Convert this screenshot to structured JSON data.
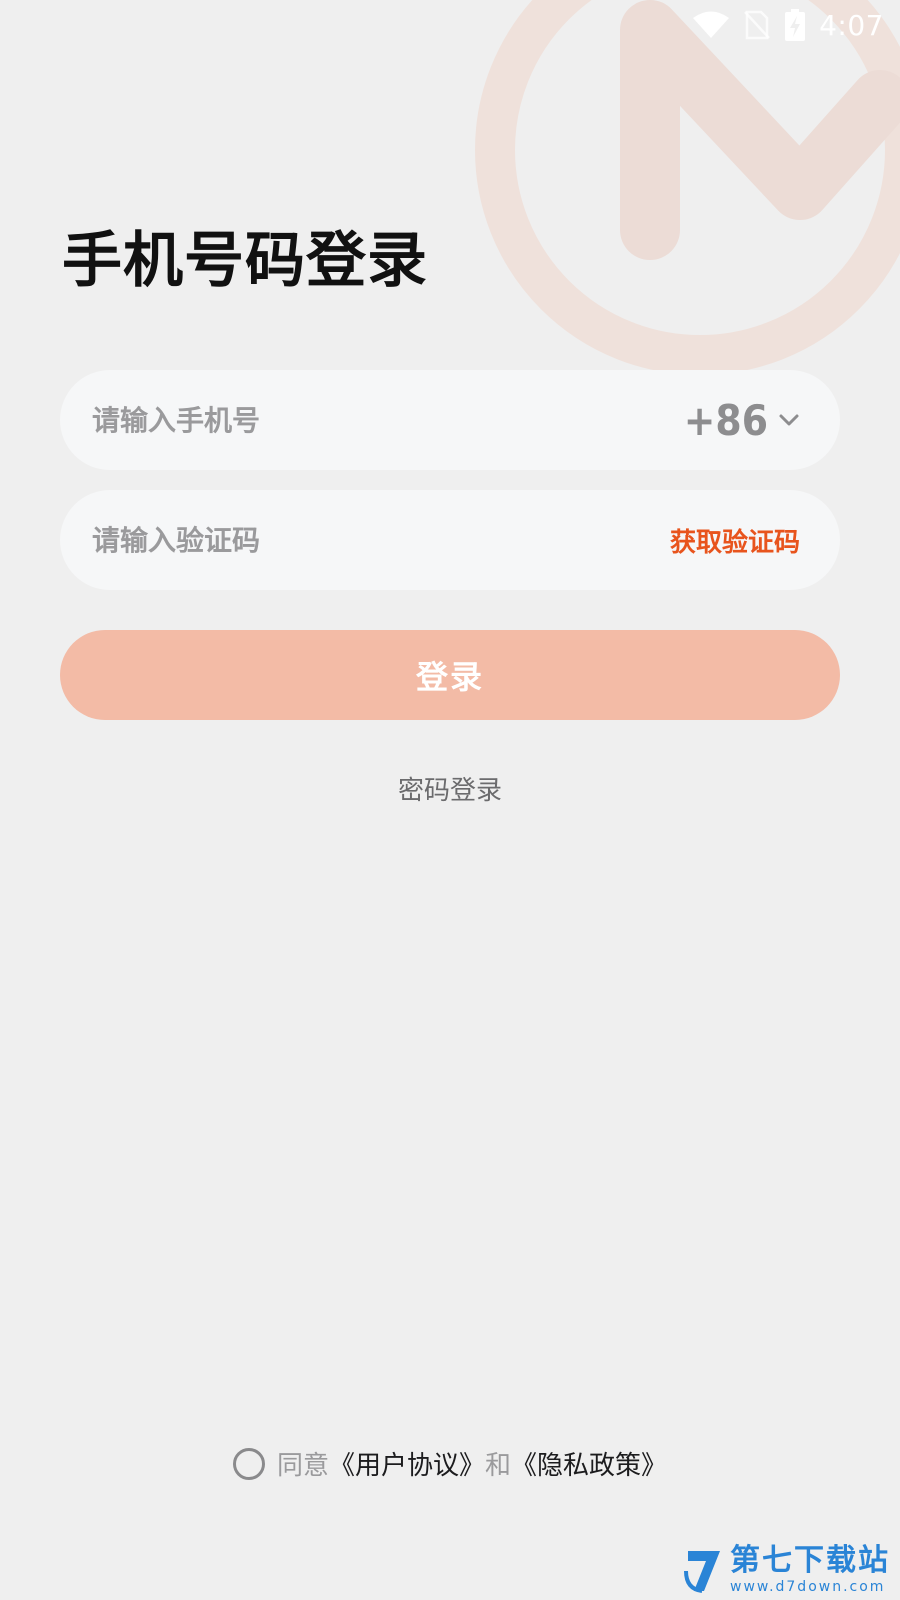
{
  "status_bar": {
    "time": "4:07"
  },
  "login": {
    "title": "手机号码登录",
    "phone_placeholder": "请输入手机号",
    "country_code": "+86",
    "code_placeholder": "请输入验证码",
    "get_code_label": "获取验证码",
    "login_button_label": "登录",
    "password_login_label": "密码登录"
  },
  "agreement": {
    "agree_text": "同意",
    "user_agreement": "《用户协议》",
    "and_text": "和",
    "privacy_policy": "《隐私政策》"
  },
  "watermark": {
    "name": "第七下载站",
    "url": "www.d7down.com"
  },
  "colors": {
    "background": "#efefef",
    "accent": "#e8541d",
    "login_button": "#f3bba6",
    "field_background": "#f6f7f8",
    "watermark": "#2a84d6"
  },
  "icons": {
    "wifi": "wifi-icon",
    "signal": "no-signal-icon",
    "battery": "battery-charging-icon",
    "dropdown": "chevron-down-icon",
    "radio": "radio-unchecked-icon",
    "logo": "brand-logo-icon"
  }
}
